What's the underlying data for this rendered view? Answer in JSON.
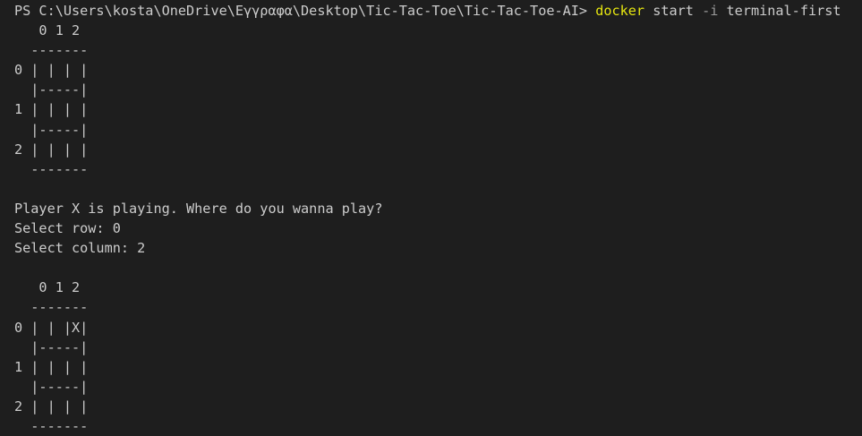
{
  "terminal": {
    "prompt": "PS C:\\Users\\kosta\\OneDrive\\Εγγραφα\\Desktop\\Tic-Tac-Toe\\Tic-Tac-Toe-AI> ",
    "command": "docker",
    "args_before_flag": " start ",
    "flag": "-i",
    "args_after_flag": " terminal-first",
    "lines": [
      "   0 1 2",
      "  -------",
      "0 | | | |",
      "  |-----|",
      "1 | | | |",
      "  |-----|",
      "2 | | | |",
      "  -------",
      "",
      "Player X is playing. Where do you wanna play?",
      "Select row: 0",
      "Select column: 2",
      "",
      "   0 1 2",
      "  -------",
      "0 | | |X|",
      "  |-----|",
      "1 | | | |",
      "  |-----|",
      "2 | | | |",
      "  -------"
    ]
  },
  "colors": {
    "background": "#1e1e1e",
    "foreground": "#cccccc",
    "command": "#e5e510",
    "flag": "#9a9a9a"
  }
}
